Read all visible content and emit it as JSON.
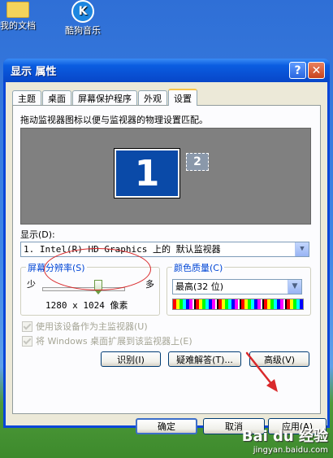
{
  "desktop": {
    "icons": [
      {
        "label": "我的文档",
        "icon": "folder-icon"
      },
      {
        "label": "酷狗音乐",
        "icon": "music-app-icon"
      }
    ]
  },
  "window": {
    "title": "显示 属性",
    "help_label": "?",
    "close_label": "✕",
    "tabs": [
      "主题",
      "桌面",
      "屏幕保护程序",
      "外观",
      "设置"
    ],
    "active_tab": "设置"
  },
  "settings": {
    "instruction": "拖动监视器图标以便与监视器的物理设置匹配。",
    "monitors": [
      {
        "number": "1",
        "primary": true
      },
      {
        "number": "2",
        "primary": false
      }
    ],
    "display_label": "显示(D):",
    "display_value": "1. Intel(R) HD Graphics 上的 默认监视器",
    "resolution": {
      "legend": "屏幕分辨率(S)",
      "min_label": "少",
      "max_label": "多",
      "slider_position": 0.68,
      "value": "1280 x 1024 像素"
    },
    "color_quality": {
      "legend": "颜色质量(C)",
      "value": "最高(32 位)"
    },
    "check_primary": "使用该设备作为主监视器(U)",
    "check_extend": "将 Windows 桌面扩展到该监视器上(E)",
    "buttons": {
      "identify": "识别(I)",
      "troubleshoot": "疑难解答(T)...",
      "advanced": "高级(V)"
    }
  },
  "dialog_buttons": {
    "ok": "确定",
    "cancel": "取消",
    "apply": "应用(A)"
  },
  "annotations": {
    "highlight_color": "#d9292b"
  },
  "watermark": {
    "brand": "Bai du 经验",
    "url": "jingyan.baidu.com"
  }
}
